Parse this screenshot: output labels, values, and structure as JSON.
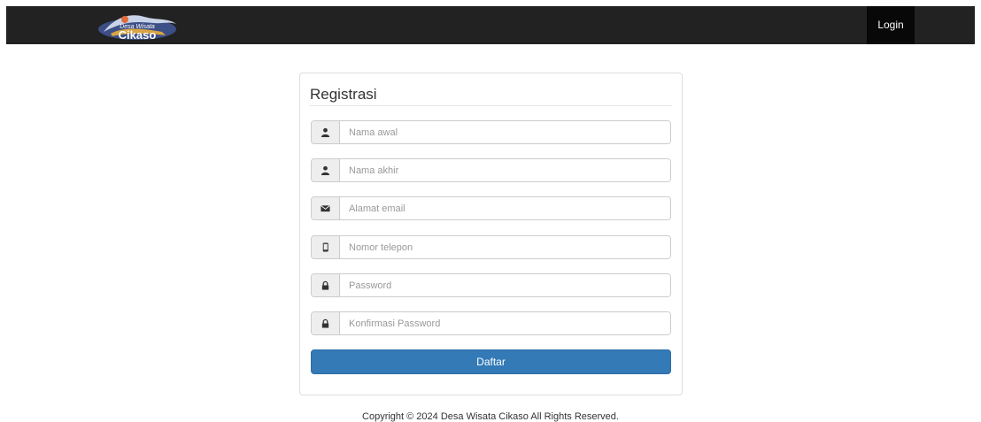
{
  "navbar": {
    "logo_icon": "cikaso-logo",
    "logo_text_top": "Desa Wisata",
    "logo_text_main": "Cikaso",
    "login_label": "Login"
  },
  "form": {
    "title": "Registrasi",
    "fields": [
      {
        "icon": "user-icon",
        "placeholder": "Nama awal",
        "value": ""
      },
      {
        "icon": "user-icon",
        "placeholder": "Nama akhir",
        "value": ""
      },
      {
        "icon": "envelope-icon",
        "placeholder": "Alamat email",
        "value": ""
      },
      {
        "icon": "phone-icon",
        "placeholder": "Nomor telepon",
        "value": ""
      },
      {
        "icon": "lock-icon",
        "placeholder": "Password",
        "value": ""
      },
      {
        "icon": "lock-icon",
        "placeholder": "Konfirmasi Password",
        "value": ""
      }
    ],
    "submit_label": "Daftar"
  },
  "footer": {
    "copyright": "Copyright © 2024 Desa Wisata Cikaso All Rights Reserved."
  },
  "colors": {
    "navbar": "#222222",
    "login_bg": "#080808",
    "primary": "#337ab7"
  }
}
